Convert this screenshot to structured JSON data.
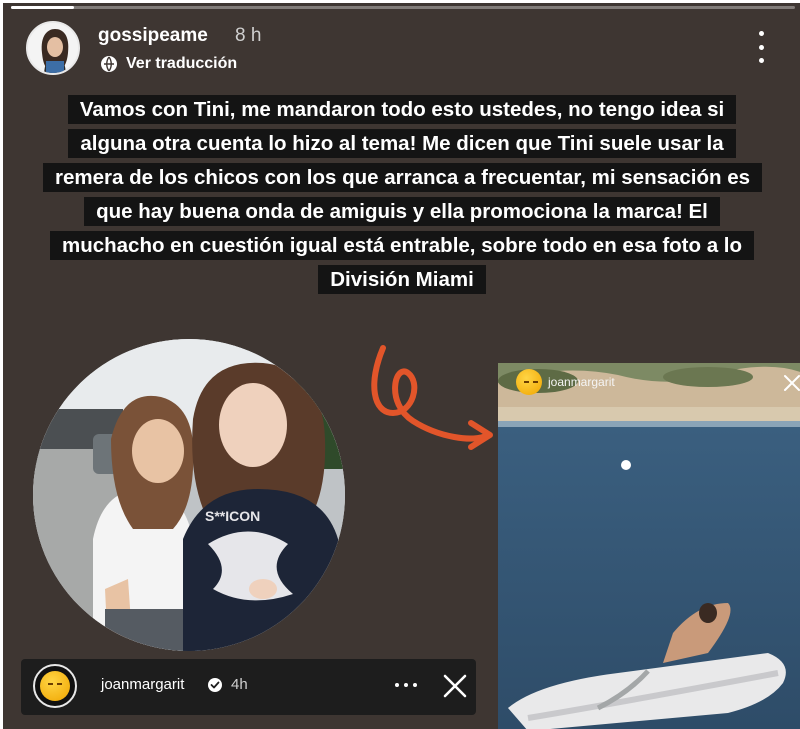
{
  "story": {
    "progress": 0.08,
    "header": {
      "username": "gossipeame",
      "time": "8 h",
      "translate_label": "Ver traducción"
    },
    "caption": "Vamos con Tini, me mandaron todo esto ustedes, no tengo idea si alguna otra cuenta lo hizo al tema! Me dicen que Tini suele usar la remera de los chicos con los que arranca a frecuentar, mi sensación es que hay buena onda de amiguis y ella promociona la marca! El muchacho en cuestión igual está entrable, sobre todo en esa foto a lo División Miami",
    "photo_left": {
      "shirt_text": "S**ICON"
    },
    "boat_story": {
      "username": "joanmargarit"
    },
    "bottom_bar": {
      "username": "joanmargarit",
      "time": "4h"
    },
    "colors": {
      "background": "#3e3632",
      "caption_bg": "#141414",
      "arrow": "#e2552a",
      "bottom_bar": "#1d1d1d"
    },
    "icons": [
      "more-vertical-icon",
      "translate-icon",
      "verified-icon",
      "more-horizontal-icon",
      "close-icon",
      "arrow-icon"
    ]
  }
}
